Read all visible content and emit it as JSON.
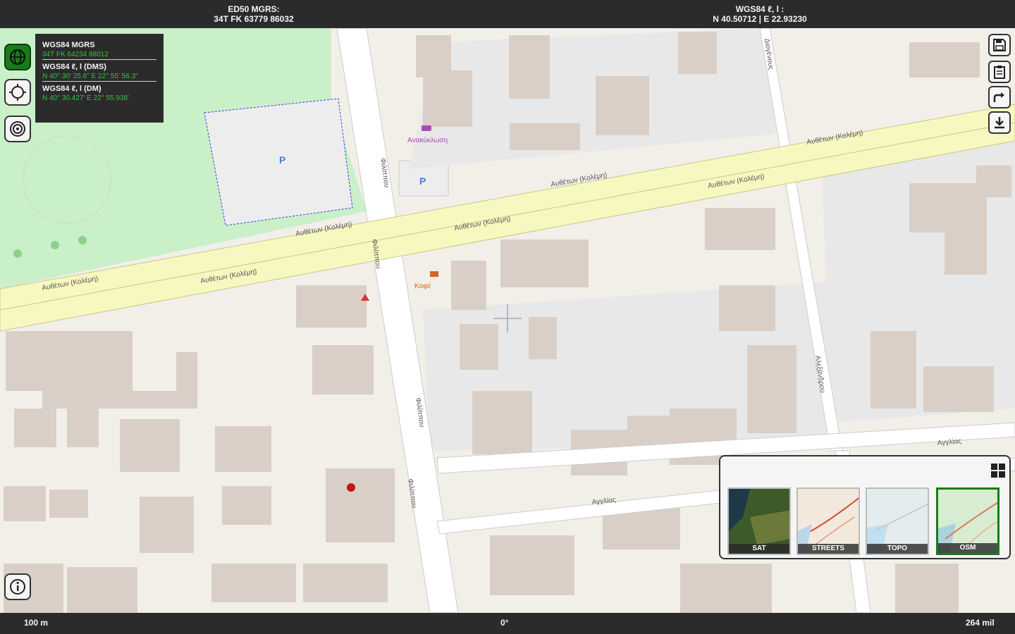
{
  "header": {
    "mgrs_title": "ED50 MGRS:",
    "mgrs_value": "34T FK 63779 86032",
    "wgs_title": "WGS84 ℓ, l :",
    "wgs_value": "N 40.50712 | E 22.93230"
  },
  "coord_panel": {
    "items": [
      {
        "title": "WGS84 MGRS",
        "value": "34T FK 64234 88012"
      },
      {
        "title": "WGS84 ℓ, l (DMS)",
        "value": "N 40° 30' 25.6\" E 22° 55' 56.3\""
      },
      {
        "title": "WGS84 ℓ, l (DM)",
        "value": "N 40° 30.427' E 22° 55.938'"
      }
    ]
  },
  "map": {
    "streets": {
      "main_road": "Αυθέτων (Κολέμη)",
      "side_road_1": "Φιλίππου",
      "side_road_2": "Διογένους",
      "side_road_3": "Αλεξάνδρου",
      "lower_road": "Αγγλίας"
    },
    "poi_label_1": "Ανακύκλωση",
    "poi_label_2": "Καφέ"
  },
  "footer": {
    "scale_left": "100 m",
    "bearing": "0°",
    "scale_right": "264 mil"
  },
  "layers": {
    "items": [
      {
        "label": "SAT"
      },
      {
        "label": "STREETS"
      },
      {
        "label": "TOPO"
      },
      {
        "label": "OSM"
      }
    ],
    "selected": "OSM"
  },
  "colors": {
    "bar_bg": "#2b2b2b",
    "accent_green": "#1a7a1a",
    "coord_green": "#3bbf3b",
    "road_fill": "#f7f7c0",
    "park_fill": "#c9f0c9"
  },
  "icons": {
    "globe": "globe-icon",
    "crosshair": "crosshair-icon",
    "target": "target-icon",
    "save": "save-icon",
    "clipboard": "clipboard-icon",
    "share": "share-icon",
    "download": "download-icon",
    "info": "info-icon",
    "grid": "grid-icon"
  }
}
